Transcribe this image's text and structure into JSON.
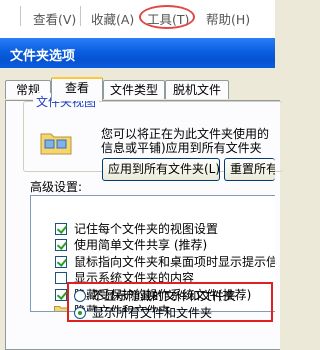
{
  "menubar": {
    "items": [
      {
        "label": "查看(V)"
      },
      {
        "label": "收藏(A)"
      },
      {
        "label": "工具(T)"
      },
      {
        "label": "帮助(H)"
      }
    ]
  },
  "dialog": {
    "title": "文件夹选项",
    "tabs": [
      {
        "label": "常规"
      },
      {
        "label": "查看"
      },
      {
        "label": "文件类型"
      },
      {
        "label": "脱机文件"
      }
    ],
    "group": {
      "title": "文件夹视图",
      "text_line1": "您可以将正在为此文件夹使用的",
      "text_line2": "信息或平铺)应用到所有文件夹",
      "apply_button": "应用到所有文件夹(L)",
      "reset_button": "重置所有文件夹"
    },
    "advanced_label": "高级设置:",
    "settings": [
      {
        "label": "记住每个文件夹的视图设置",
        "checked": true
      },
      {
        "label": "使用简单文件共享 (推荐)",
        "checked": true
      },
      {
        "label": "鼠标指向文件夹和桌面项时显示提示信",
        "checked": true
      },
      {
        "label": "显示系统文件夹的内容",
        "checked": false
      },
      {
        "label": "隐藏受保护的操作系统文件(推荐)",
        "checked": true
      }
    ],
    "hidden_folder_label": "隐藏文件和文件夹",
    "hidden_options": [
      {
        "label": "不显示隐藏的文件和文件夹",
        "selected": false
      },
      {
        "label": "显示所有文件和文件夹",
        "selected": true
      }
    ]
  },
  "colors": {
    "title_bar": "#0a5fe2",
    "highlight": "#e02020",
    "check": "#21a121"
  }
}
